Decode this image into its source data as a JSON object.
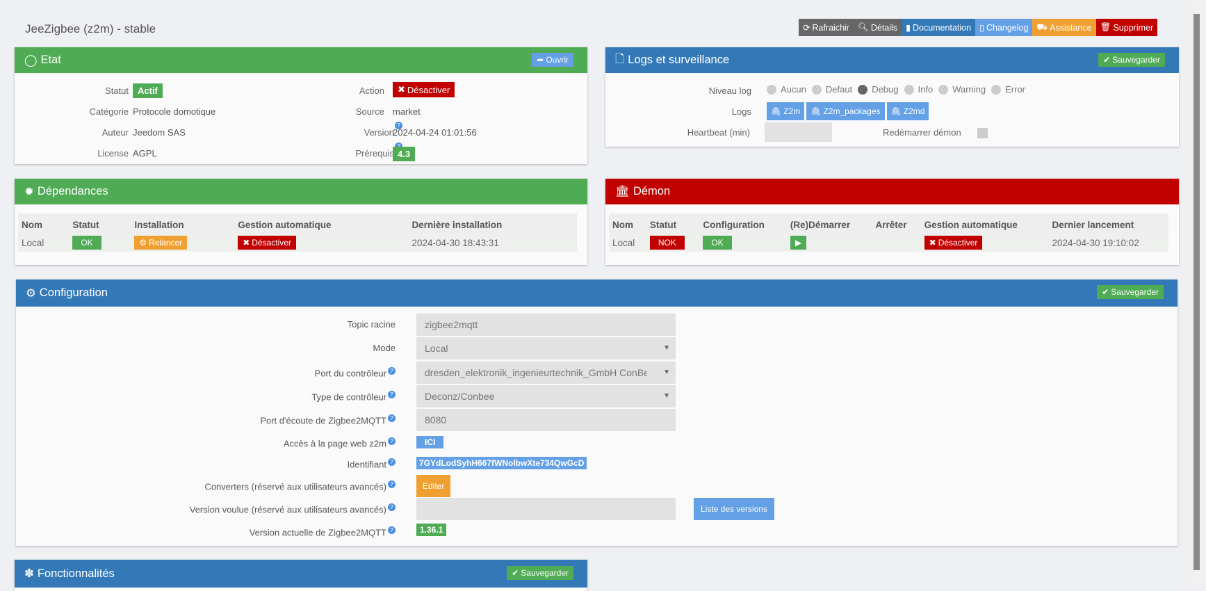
{
  "title": "JeeZigbee (z2m) - stable",
  "toolbar": {
    "refresh": "Rafraichir",
    "details": "Détails",
    "doc": "Documentation",
    "changelog": "Changelog",
    "assist": "Assistance",
    "delete": "Supprimer"
  },
  "etat": {
    "title": "Etat",
    "open": "Ouvrir",
    "statut_l": "Statut",
    "statut": "Actif",
    "categorie_l": "Catégorie",
    "categorie": "Protocole domotique",
    "auteur_l": "Auteur",
    "auteur": "Jeedom SAS",
    "license_l": "License",
    "license": "AGPL",
    "action_l": "Action",
    "action": "Désactiver",
    "source_l": "Source",
    "source": "market",
    "version_l": "Version",
    "version": "2024-04-24 01:01:56",
    "prereq_l": "Prérequis",
    "prereq": "4.3"
  },
  "logs": {
    "title": "Logs et surveillance",
    "save": "Sauvegarder",
    "niveau_l": "Niveau log",
    "levels": [
      "Aucun",
      "Defaut",
      "Debug",
      "Info",
      "Warning",
      "Error"
    ],
    "selected": "Debug",
    "logs_l": "Logs",
    "files": [
      "Z2m",
      "Z2m_packages",
      "Z2md"
    ],
    "heartbeat_l": "Heartbeat (min)",
    "heartbeat": "",
    "restart_l": "Redémarrer démon"
  },
  "deps": {
    "title": "Dépendances",
    "headers": [
      "Nom",
      "Statut",
      "Installation",
      "Gestion automatique",
      "Dernière installation"
    ],
    "nom": "Local",
    "statut": "OK",
    "install": "Relancer",
    "gestion": "Désactiver",
    "date": "2024-04-30 18:43:31"
  },
  "demon": {
    "title": "Démon",
    "headers": [
      "Nom",
      "Statut",
      "Configuration",
      "(Re)Démarrer",
      "Arrêter",
      "Gestion automatique",
      "Dernier lancement"
    ],
    "nom": "Local",
    "statut": "NOK",
    "config": "OK",
    "gestion": "Désactiver",
    "date": "2024-04-30 19:10:02"
  },
  "config": {
    "title": "Configuration",
    "save": "Sauvegarder",
    "topic_l": "Topic racine",
    "topic": "zigbee2mqtt",
    "mode_l": "Mode",
    "mode": "Local",
    "port_l": "Port du contrôleur",
    "port": "dresden_elektronik_ingenieurtechnik_GmbH ConBee_II",
    "type_l": "Type de contrôleur",
    "type": "Deconz/Conbee",
    "listen_l": "Port d'écoute de Zigbee2MQTT",
    "listen": "8080",
    "web_l": "Accès à la page web z2m",
    "web": "ICI",
    "id_l": "Identifiant",
    "id": "7GYdLodSyhH667fWNolbwXte734QwGcD",
    "conv_l": "Converters (réservé aux utilisateurs avancés)",
    "conv": "Editer",
    "wanted_l": "Version voulue (réservé aux utilisateurs avancés)",
    "wanted": "",
    "versions": "Liste des versions",
    "current_l": "Version actuelle de Zigbee2MQTT",
    "current": "1.36.1"
  },
  "fonct": {
    "title": "Fonctionnalités",
    "save": "Sauvegarder"
  }
}
